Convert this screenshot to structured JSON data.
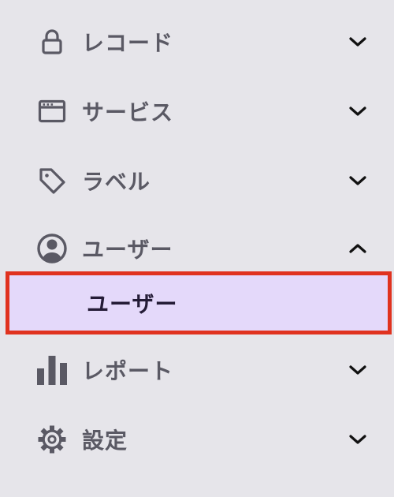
{
  "menu": {
    "items": [
      {
        "label": "レコード",
        "icon": "lock-icon",
        "expanded": false
      },
      {
        "label": "サービス",
        "icon": "browser-window-icon",
        "expanded": false
      },
      {
        "label": "ラベル",
        "icon": "tag-icon",
        "expanded": false
      },
      {
        "label": "ユーザー",
        "icon": "user-circle-icon",
        "expanded": true,
        "children": [
          {
            "label": "ユーザー",
            "selected": true
          }
        ]
      },
      {
        "label": "レポート",
        "icon": "bar-chart-icon",
        "expanded": false
      },
      {
        "label": "設定",
        "icon": "gear-icon",
        "expanded": false
      }
    ]
  },
  "colors": {
    "background": "#e6e5ea",
    "text": "#5a5964",
    "selected_background": "#e4d9fa",
    "selected_text": "#241c36",
    "highlight_border": "#e0321f"
  }
}
